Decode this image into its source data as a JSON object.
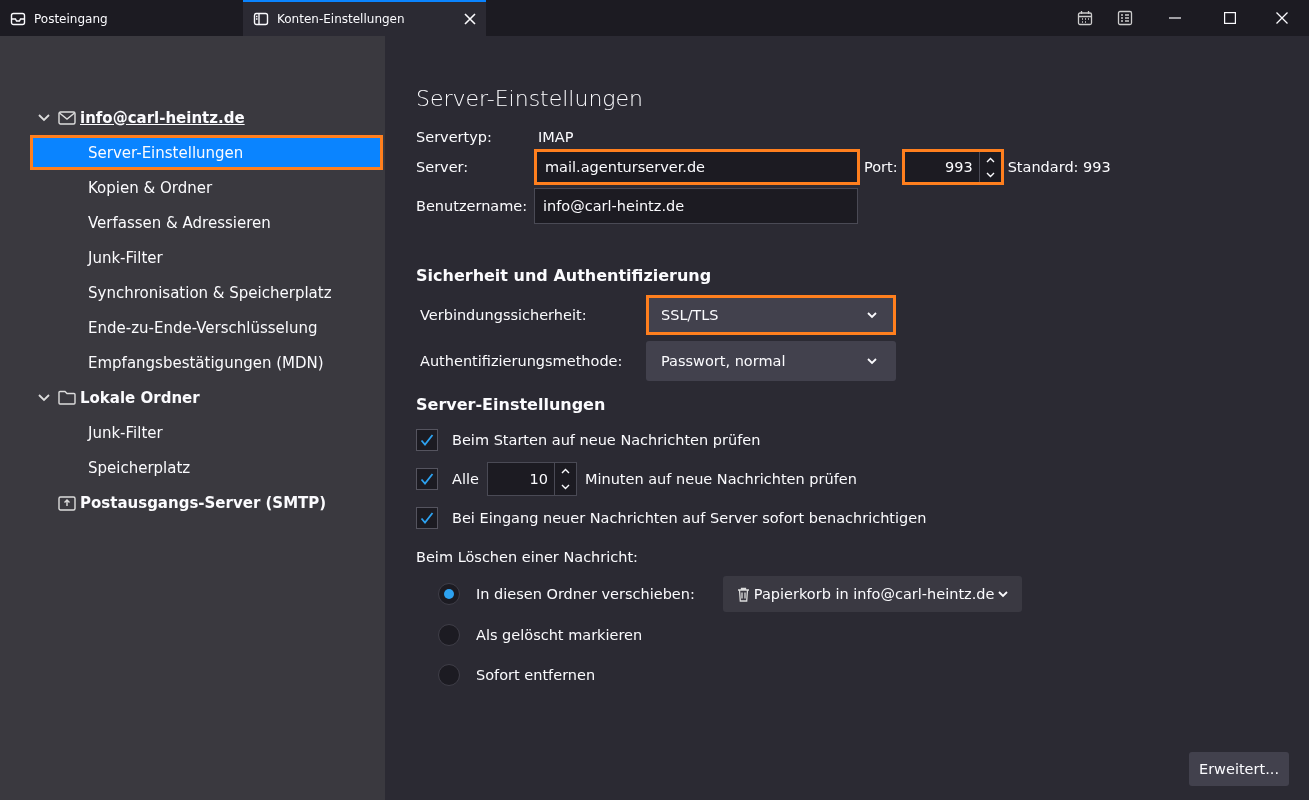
{
  "tabs": [
    {
      "label": "Posteingang",
      "kind": "mail",
      "selected": false
    },
    {
      "label": "Konten-Einstellungen",
      "kind": "settings",
      "selected": true
    }
  ],
  "sidebar": {
    "accounts": [
      {
        "label": "info@carl-heintz.de",
        "kind": "mail",
        "expanded": true,
        "children": [
          {
            "label": "Server-Einstellungen",
            "selected": true,
            "highlighted": true
          },
          {
            "label": "Kopien & Ordner",
            "selected": false,
            "highlighted": false
          },
          {
            "label": "Verfassen & Adressieren",
            "selected": false,
            "highlighted": false
          },
          {
            "label": "Junk-Filter",
            "selected": false,
            "highlighted": false
          },
          {
            "label": "Synchronisation & Speicherplatz",
            "selected": false,
            "highlighted": false
          },
          {
            "label": "Ende-zu-Ende-Verschlüsselung",
            "selected": false,
            "highlighted": false
          },
          {
            "label": "Empfangsbestätigungen (MDN)",
            "selected": false,
            "highlighted": false
          }
        ]
      },
      {
        "label": "Lokale Ordner",
        "kind": "folder",
        "expanded": true,
        "children": [
          {
            "label": "Junk-Filter",
            "selected": false,
            "highlighted": false
          },
          {
            "label": "Speicherplatz",
            "selected": false,
            "highlighted": false
          }
        ]
      },
      {
        "label": "Postausgangs-Server (SMTP)",
        "kind": "outbox"
      }
    ]
  },
  "content": {
    "title": "Server-Einstellungen",
    "server_type": {
      "label": "Servertyp:",
      "value": "IMAP"
    },
    "server": {
      "label": "Server:",
      "value": "mail.agenturserver.de",
      "highlighted": true
    },
    "port": {
      "label": "Port:",
      "value": "993",
      "highlighted": true
    },
    "port_default": "Standard: 993",
    "username": {
      "label": "Benutzername:",
      "value": "info@carl-heintz.de"
    },
    "security": {
      "heading": "Sicherheit und Authentifizierung",
      "connection": {
        "label": "Verbindungssicherheit:",
        "value": "SSL/TLS",
        "highlighted": true
      },
      "auth": {
        "label": "Authentifizierungsmethode:",
        "value": "Passwort, normal",
        "highlighted": false
      }
    },
    "server_settings": {
      "heading": "Server-Einstellungen",
      "checks": [
        {
          "kind": "plain",
          "label": "Beim Starten auf neue Nachrichten prüfen",
          "checked": true
        },
        {
          "kind": "interval",
          "label": "Alle",
          "value": "10",
          "suffix": "Minuten auf neue Nachrichten prüfen",
          "checked": true
        },
        {
          "kind": "plain",
          "label": "Bei Eingang neuer Nachrichten auf Server sofort benachrichtigen",
          "checked": true
        }
      ]
    },
    "delete": {
      "label": "Beim Löschen einer Nachricht:",
      "options": [
        {
          "label": "In diesen Ordner verschieben:",
          "selected": true,
          "folder": "Papierkorb in info@carl-heintz.de"
        },
        {
          "label": "Als gelöscht markieren",
          "selected": false
        },
        {
          "label": "Sofort entfernen",
          "selected": false
        }
      ]
    },
    "advanced_button": "Erweitert..."
  }
}
